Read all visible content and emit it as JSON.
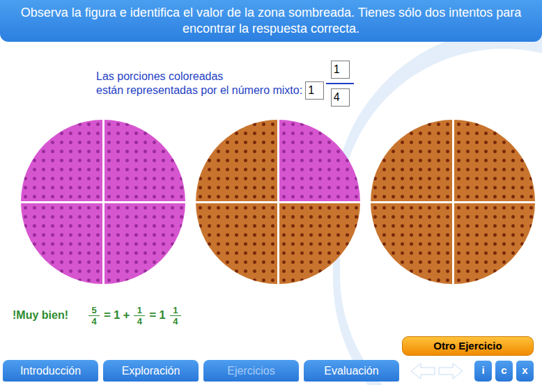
{
  "instructions": "Observa la figura e identifica el valor de la zona sombreada. Tienes sólo dos intentos para encontrar la respuesta correcta.",
  "prompt": {
    "line1": "Las porciones coloreadas",
    "line2": "están representadas por el número mixto:"
  },
  "answer": {
    "whole": "1",
    "numerator": "1",
    "denominator": "4"
  },
  "pizzas": [
    {
      "quarters": [
        {
          "shaded": true
        },
        {
          "shaded": true
        },
        {
          "shaded": true
        },
        {
          "shaded": true
        }
      ]
    },
    {
      "quarters": [
        {
          "shaded": false
        },
        {
          "shaded": true
        },
        {
          "shaded": false
        },
        {
          "shaded": false
        }
      ]
    },
    {
      "quarters": [
        {
          "shaded": false
        },
        {
          "shaded": false
        },
        {
          "shaded": false
        },
        {
          "shaded": false
        }
      ]
    }
  ],
  "feedback": {
    "message": "!Muy bien!",
    "equation": [
      {
        "kind": "fraction",
        "numerator": "5",
        "denominator": "4"
      },
      {
        "kind": "text",
        "text": "="
      },
      {
        "kind": "text",
        "text": "1"
      },
      {
        "kind": "text",
        "text": "+"
      },
      {
        "kind": "fraction",
        "numerator": "1",
        "denominator": "4"
      },
      {
        "kind": "text",
        "text": "="
      },
      {
        "kind": "text",
        "text": "1"
      },
      {
        "kind": "fraction",
        "numerator": "1",
        "denominator": "4"
      }
    ]
  },
  "button": "Otro Ejercicio",
  "nav": {
    "tabs": [
      {
        "label": "Introducción",
        "selected": false
      },
      {
        "label": "Exploración",
        "selected": false
      },
      {
        "label": "Ejercicios",
        "selected": true
      },
      {
        "label": "Evaluación",
        "selected": false
      }
    ],
    "tools": [
      "i",
      "c",
      "x"
    ]
  }
}
